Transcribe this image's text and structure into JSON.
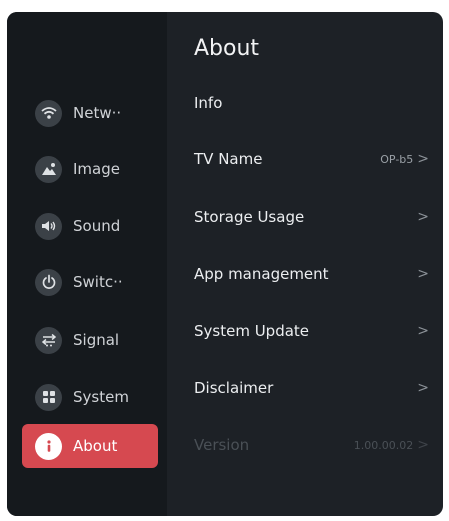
{
  "sidebar": {
    "items": [
      {
        "label": "Netw··",
        "icon": "wifi-icon"
      },
      {
        "label": "Image",
        "icon": "picture-icon"
      },
      {
        "label": "Sound",
        "icon": "speaker-icon"
      },
      {
        "label": "Switc··",
        "icon": "power-icon"
      },
      {
        "label": "Signal",
        "icon": "signal-icon"
      },
      {
        "label": "System",
        "icon": "grid-icon"
      },
      {
        "label": "About",
        "icon": "info-icon",
        "active": true
      }
    ]
  },
  "main": {
    "title": "About",
    "rows": [
      {
        "label": "Info",
        "value": ""
      },
      {
        "label": "TV Name",
        "value": "OP-b5"
      },
      {
        "label": "Storage Usage",
        "value": ""
      },
      {
        "label": "App management",
        "value": ""
      },
      {
        "label": "System Update",
        "value": ""
      },
      {
        "label": "Disclaimer",
        "value": ""
      },
      {
        "label": "Version",
        "value": "1.00.00.02"
      }
    ]
  },
  "colors": {
    "background": "#1d2126",
    "sidebar": "#15191d",
    "accent": "#d64950"
  }
}
